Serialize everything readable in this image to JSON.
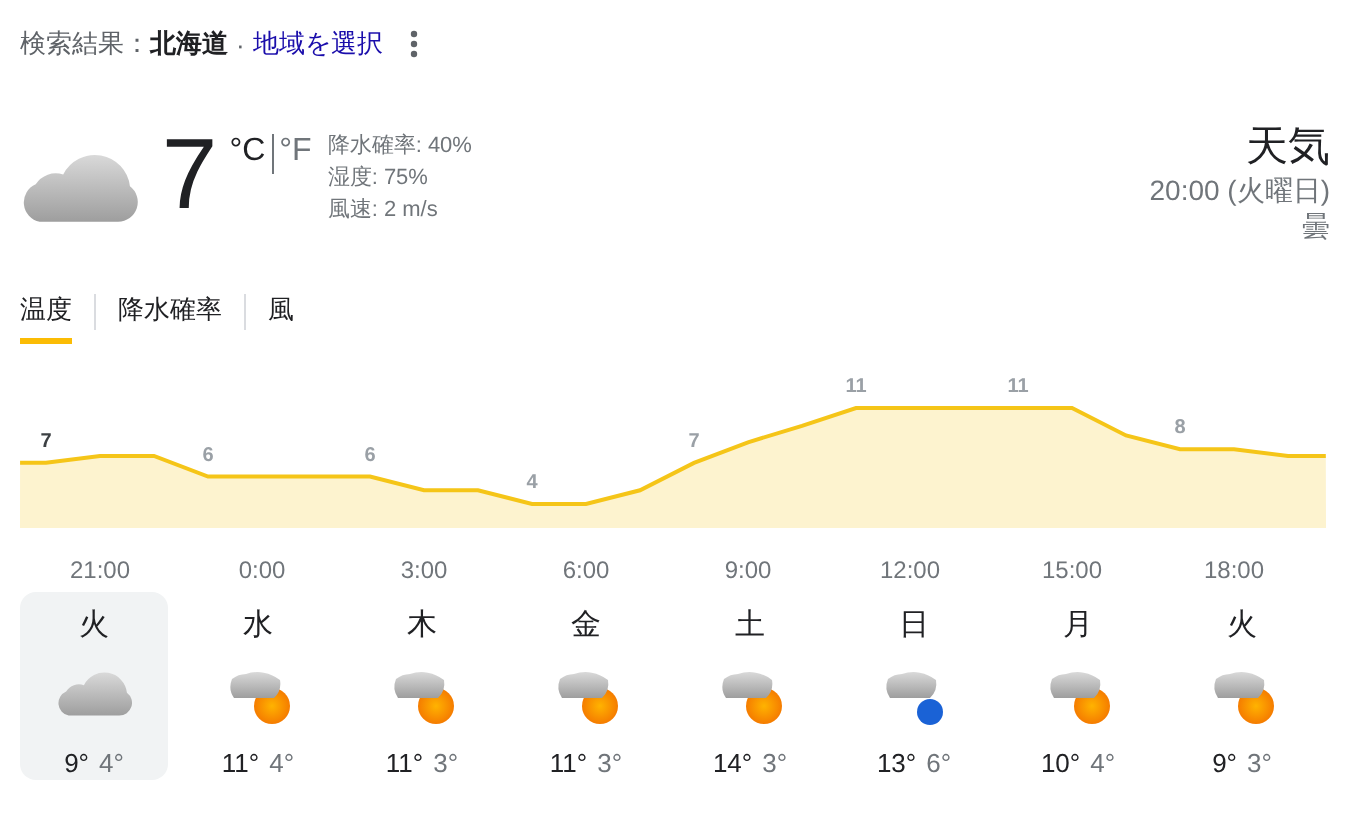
{
  "header": {
    "prefix": "検索結果：",
    "location": "北海道",
    "separator": "·",
    "link": "地域を選択"
  },
  "current": {
    "kind": "cloudy",
    "temperature": "7",
    "units": [
      {
        "label": "°C",
        "selected": true
      },
      {
        "label": "°F",
        "selected": false
      }
    ],
    "details": [
      "降水確率: 40%",
      "湿度: 75%",
      "風速: 2 m/s"
    ]
  },
  "summary": {
    "title": "天気",
    "time": "20:00 (火曜日)",
    "condition": "曇"
  },
  "tabs": [
    {
      "label": "温度",
      "selected": true
    },
    {
      "label": "降水確率",
      "selected": false
    },
    {
      "label": "風",
      "selected": false
    }
  ],
  "chart": {
    "temperature_labels": [
      "7",
      "6",
      "6",
      "4",
      "7",
      "11",
      "11",
      "8"
    ],
    "time_labels": [
      "21:00",
      "0:00",
      "3:00",
      "6:00",
      "9:00",
      "12:00",
      "15:00",
      "18:00"
    ]
  },
  "days": [
    {
      "day": "火",
      "kind": "cloudy",
      "high": "9°",
      "low": "4°",
      "selected": true
    },
    {
      "day": "水",
      "kind": "sun_cloud",
      "high": "11°",
      "low": "4°",
      "selected": false
    },
    {
      "day": "木",
      "kind": "sun_cloud",
      "high": "11°",
      "low": "3°",
      "selected": false
    },
    {
      "day": "金",
      "kind": "sun_cloud",
      "high": "11°",
      "low": "3°",
      "selected": false
    },
    {
      "day": "土",
      "kind": "sun_cloud",
      "high": "14°",
      "low": "3°",
      "selected": false
    },
    {
      "day": "日",
      "kind": "rain_cloud",
      "high": "13°",
      "low": "6°",
      "selected": false
    },
    {
      "day": "月",
      "kind": "sun_cloud",
      "high": "10°",
      "low": "4°",
      "selected": false
    },
    {
      "day": "火",
      "kind": "sun_cloud",
      "high": "9°",
      "low": "3°",
      "selected": false
    }
  ]
}
